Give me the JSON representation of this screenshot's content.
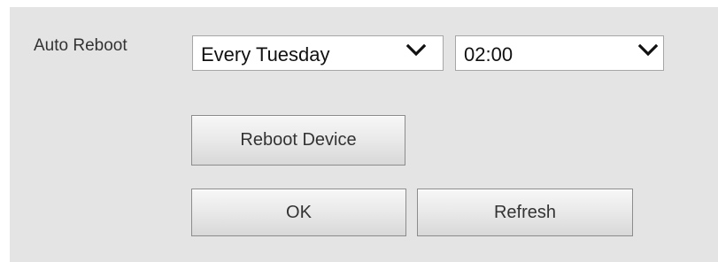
{
  "auto_reboot": {
    "label": "Auto Reboot",
    "day_select": {
      "value": "Every Tuesday",
      "icon": "chevron-down-icon"
    },
    "time_select": {
      "value": "02:00",
      "icon": "chevron-down-icon"
    }
  },
  "buttons": {
    "reboot_label": "Reboot Device",
    "ok_label": "OK",
    "refresh_label": "Refresh"
  },
  "colors": {
    "panel_background": "#e4e4e4",
    "text": "#333333",
    "select_background": "#ffffff"
  }
}
